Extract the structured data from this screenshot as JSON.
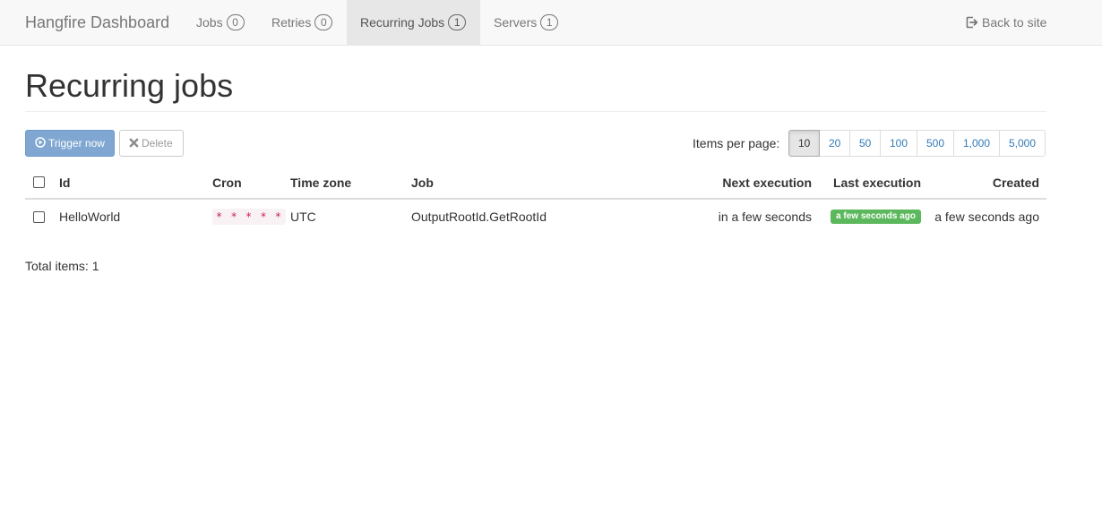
{
  "navbar": {
    "brand": "Hangfire Dashboard",
    "items": [
      {
        "label": "Jobs",
        "count": "0"
      },
      {
        "label": "Retries",
        "count": "0"
      },
      {
        "label": "Recurring Jobs",
        "count": "1"
      },
      {
        "label": "Servers",
        "count": "1"
      }
    ],
    "active_item": "Recurring Jobs",
    "back_link": "Back to site"
  },
  "page": {
    "title": "Recurring jobs"
  },
  "toolbar": {
    "trigger_label": "Trigger now",
    "delete_label": "Delete",
    "items_per_page_label": "Items per page:",
    "page_sizes": [
      "10",
      "20",
      "50",
      "100",
      "500",
      "1,000",
      "5,000"
    ],
    "selected_page_size": "10"
  },
  "table": {
    "headers": {
      "id": "Id",
      "cron": "Cron",
      "time_zone": "Time zone",
      "job": "Job",
      "next_execution": "Next execution",
      "last_execution": "Last execution",
      "created": "Created"
    },
    "rows": [
      {
        "id": "HelloWorld",
        "cron": "* * * * *",
        "time_zone": "UTC",
        "job": "OutputRootId.GetRootId",
        "next_execution": "in a few seconds",
        "last_execution": "a few seconds ago",
        "created": "a few seconds ago"
      }
    ]
  },
  "footer": {
    "total_items": "Total items: 1"
  },
  "colors": {
    "primary_button": "#7fa7d1",
    "success_label": "#5cb85c",
    "cron_text": "#c7254e",
    "link": "#337ab7"
  }
}
